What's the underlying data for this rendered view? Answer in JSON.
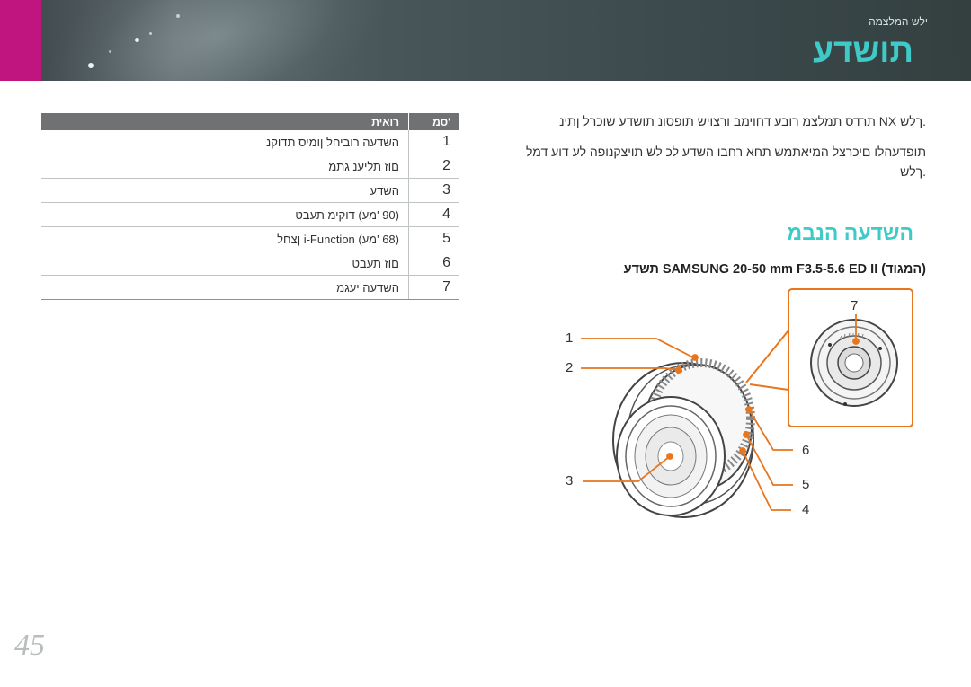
{
  "header": {
    "breadcrumb": "ילש המלצמה",
    "title": "תושדע"
  },
  "intro": {
    "line1": ".ךלש NX תרדס תמלצמ רובע דחוימב ורצויש תופסונ תושדע שוכרל ןתינ",
    "line2": "תופדעהלו םיכרצל המיאתמש תחא רחבו השדע לכ לש תויצקנופה לע דוע דמל",
    "line3": ".ךלש"
  },
  "section": {
    "title": "השדעה הנבמ",
    "lens_title": "(המגוד) SAMSUNG 20-50 mm F3.5-5.6 ED II תשדע"
  },
  "table": {
    "header": {
      "num": "'סמ",
      "desc": "רואית"
    },
    "rows": [
      {
        "num": "1",
        "desc": "השדעה רוביחל ןומיס תדוקנ"
      },
      {
        "num": "2",
        "desc": "םוז תליענ גתמ"
      },
      {
        "num": "3",
        "desc": "השדע"
      },
      {
        "num": "4",
        "desc": "(90 'מע) דוקימ תעבט"
      },
      {
        "num": "5",
        "desc": "(68 'מע) i-Function ןצחל"
      },
      {
        "num": "6",
        "desc": "םוז תעבט"
      },
      {
        "num": "7",
        "desc": "השדעה יעגמ"
      }
    ]
  },
  "figure": {
    "callouts": [
      "1",
      "2",
      "3",
      "4",
      "5",
      "6",
      "7"
    ]
  },
  "page_number": "45",
  "colors": {
    "accent": "#3ecbc7",
    "brand_tab": "#c0157f",
    "callout_line": "#e8761e",
    "table_header": "#6f7173"
  }
}
